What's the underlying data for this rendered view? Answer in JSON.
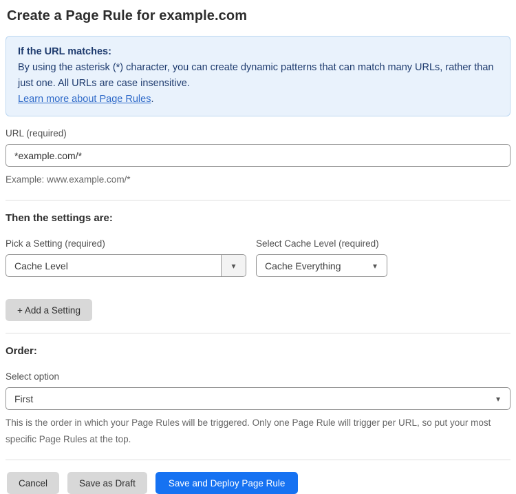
{
  "page": {
    "title": "Create a Page Rule for example.com"
  },
  "info_box": {
    "heading": "If the URL matches:",
    "body": "By using the asterisk (*) character, you can create dynamic patterns that can match many URLs, rather than just one. All URLs are case insensitive.",
    "link_label": "Learn more about Page Rules",
    "link_suffix": "."
  },
  "url_field": {
    "label": "URL (required)",
    "value": "*example.com/*",
    "example": "Example: www.example.com/*"
  },
  "settings": {
    "heading": "Then the settings are:",
    "setting_select": {
      "label": "Pick a Setting (required)",
      "value": "Cache Level"
    },
    "cache_level_select": {
      "label": "Select Cache Level (required)",
      "value": "Cache Everything"
    },
    "add_button_label": "+ Add a Setting"
  },
  "order": {
    "heading": "Order:",
    "select_label": "Select option",
    "value": "First",
    "help": "This is the order in which your Page Rules will be triggered. Only one Page Rule will trigger per URL, so put your most specific Page Rules at the top."
  },
  "footer": {
    "cancel_label": "Cancel",
    "save_draft_label": "Save as Draft",
    "save_deploy_label": "Save and Deploy Page Rule"
  },
  "icons": {
    "dropdown_arrow": "▾"
  },
  "colors": {
    "primary_blue": "#1672f2",
    "info_background": "#e9f2fc",
    "info_border": "#bcd7f1",
    "info_text": "#1e3b6e",
    "link_blue": "#2c68c8",
    "button_gray": "#d8d8d8"
  }
}
